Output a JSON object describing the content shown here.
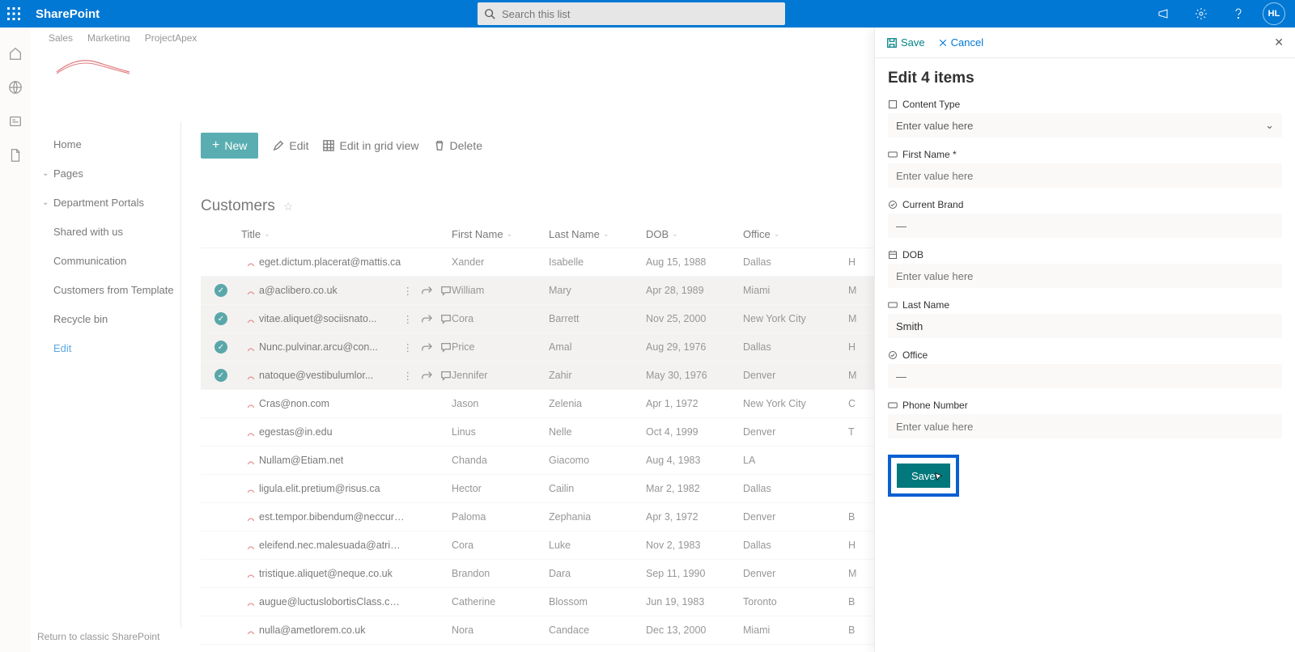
{
  "suite": {
    "brand": "SharePoint",
    "search_placeholder": "Search this list",
    "avatar": "HL"
  },
  "topnav": {
    "items": [
      "Sales",
      "Marketing",
      "ProjectApex"
    ]
  },
  "sidebar": {
    "home": "Home",
    "pages": "Pages",
    "dept": "Department Portals",
    "items": [
      "Shared with us",
      "Communication",
      "Customers from Template",
      "Recycle bin"
    ],
    "edit": "Edit"
  },
  "footer_link": "Return to classic SharePoint",
  "cmdbar": {
    "new": "New",
    "edit": "Edit",
    "grid": "Edit in grid view",
    "delete": "Delete"
  },
  "list": {
    "title": "Customers"
  },
  "columns": [
    "Title",
    "First Name",
    "Last Name",
    "DOB",
    "Office",
    ""
  ],
  "rows": [
    {
      "sel": false,
      "title": "eget.dictum.placerat@mattis.ca",
      "first": "Xander",
      "last": "Isabelle",
      "dob": "Aug 15, 1988",
      "office": "Dallas",
      "col6": "H"
    },
    {
      "sel": true,
      "title": "a@aclibero.co.uk",
      "first": "William",
      "last": "Mary",
      "dob": "Apr 28, 1989",
      "office": "Miami",
      "col6": "M"
    },
    {
      "sel": true,
      "title": "vitae.aliquet@sociisnato...",
      "first": "Cora",
      "last": "Barrett",
      "dob": "Nov 25, 2000",
      "office": "New York City",
      "col6": "M"
    },
    {
      "sel": true,
      "title": "Nunc.pulvinar.arcu@con...",
      "first": "Price",
      "last": "Amal",
      "dob": "Aug 29, 1976",
      "office": "Dallas",
      "col6": "H"
    },
    {
      "sel": true,
      "title": "natoque@vestibulumlor...",
      "first": "Jennifer",
      "last": "Zahir",
      "dob": "May 30, 1976",
      "office": "Denver",
      "col6": "M"
    },
    {
      "sel": false,
      "title": "Cras@non.com",
      "first": "Jason",
      "last": "Zelenia",
      "dob": "Apr 1, 1972",
      "office": "New York City",
      "col6": "C"
    },
    {
      "sel": false,
      "title": "egestas@in.edu",
      "first": "Linus",
      "last": "Nelle",
      "dob": "Oct 4, 1999",
      "office": "Denver",
      "col6": "T"
    },
    {
      "sel": false,
      "title": "Nullam@Etiam.net",
      "first": "Chanda",
      "last": "Giacomo",
      "dob": "Aug 4, 1983",
      "office": "LA",
      "col6": ""
    },
    {
      "sel": false,
      "title": "ligula.elit.pretium@risus.ca",
      "first": "Hector",
      "last": "Cailin",
      "dob": "Mar 2, 1982",
      "office": "Dallas",
      "col6": ""
    },
    {
      "sel": false,
      "title": "est.tempor.bibendum@neccursusa.com",
      "first": "Paloma",
      "last": "Zephania",
      "dob": "Apr 3, 1972",
      "office": "Denver",
      "col6": "B"
    },
    {
      "sel": false,
      "title": "eleifend.nec.malesuada@atrisus.ca",
      "first": "Cora",
      "last": "Luke",
      "dob": "Nov 2, 1983",
      "office": "Dallas",
      "col6": "H"
    },
    {
      "sel": false,
      "title": "tristique.aliquet@neque.co.uk",
      "first": "Brandon",
      "last": "Dara",
      "dob": "Sep 11, 1990",
      "office": "Denver",
      "col6": "M"
    },
    {
      "sel": false,
      "title": "augue@luctuslobortisClass.co.uk",
      "first": "Catherine",
      "last": "Blossom",
      "dob": "Jun 19, 1983",
      "office": "Toronto",
      "col6": "B"
    },
    {
      "sel": false,
      "title": "nulla@ametlorem.co.uk",
      "first": "Nora",
      "last": "Candace",
      "dob": "Dec 13, 2000",
      "office": "Miami",
      "col6": "B"
    }
  ],
  "panel": {
    "save": "Save",
    "cancel": "Cancel",
    "title": "Edit 4 items",
    "content_type_label": "Content Type",
    "content_type_ph": "Enter value here",
    "first_name_label": "First Name *",
    "first_name_ph": "Enter value here",
    "brand_label": "Current Brand",
    "brand_value": "—",
    "dob_label": "DOB",
    "dob_ph": "Enter value here",
    "last_name_label": "Last Name",
    "last_name_value": "Smith",
    "office_label": "Office",
    "office_value": "—",
    "phone_label": "Phone Number",
    "phone_ph": "Enter value here",
    "save_btn": "Save"
  }
}
